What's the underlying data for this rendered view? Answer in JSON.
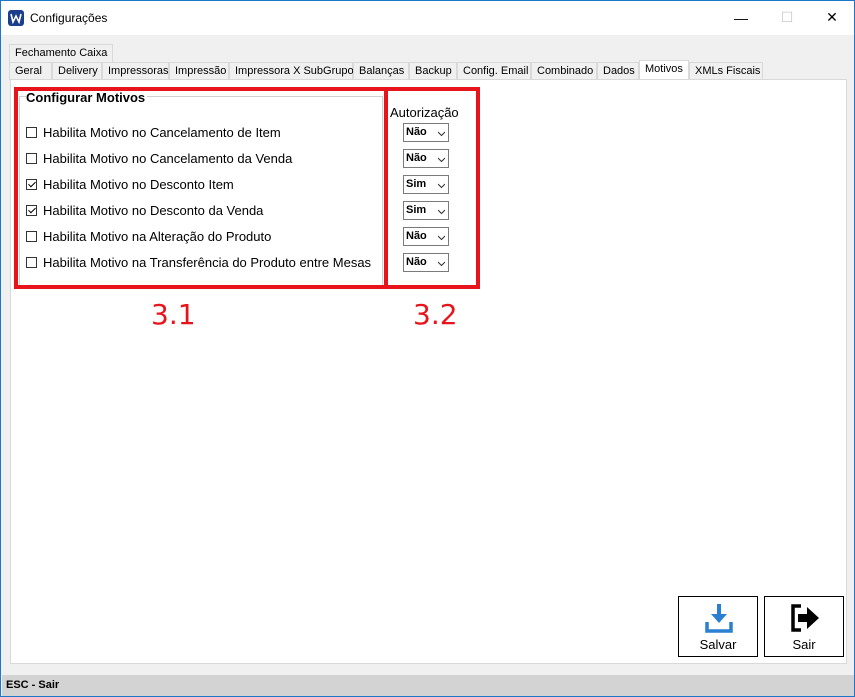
{
  "window": {
    "title": "Configurações",
    "minimize_glyph": "—",
    "maximize_glyph": "☐",
    "close_glyph": "✕"
  },
  "tabs_row1": [
    {
      "label": "Fechamento Caixa"
    }
  ],
  "tabs_row2": [
    {
      "label": "Geral"
    },
    {
      "label": "Delivery"
    },
    {
      "label": "Impressoras"
    },
    {
      "label": "Impressão"
    },
    {
      "label": "Impressora X SubGrupo"
    },
    {
      "label": "Balanças"
    },
    {
      "label": "Backup"
    },
    {
      "label": "Config. Email"
    },
    {
      "label": "Combinado"
    },
    {
      "label": "Dados"
    },
    {
      "label": "Motivos",
      "active": true
    },
    {
      "label": "XMLs Fiscais"
    }
  ],
  "motivos": {
    "group_title": "Configurar Motivos",
    "authorization_label": "Autorização",
    "items": [
      {
        "label": "Habilita Motivo no Cancelamento de Item",
        "checked": false,
        "authorization": "Não"
      },
      {
        "label": "Habilita Motivo no Cancelamento da Venda",
        "checked": false,
        "authorization": "Não"
      },
      {
        "label": "Habilita Motivo no Desconto Item",
        "checked": true,
        "authorization": "Sim"
      },
      {
        "label": "Habilita Motivo no Desconto da Venda",
        "checked": true,
        "authorization": "Sim"
      },
      {
        "label": "Habilita Motivo na Alteração do Produto",
        "checked": false,
        "authorization": "Não"
      },
      {
        "label": "Habilita Motivo na Transferência do Produto entre Mesas",
        "checked": false,
        "authorization": "Não"
      }
    ]
  },
  "annotations": {
    "left": "3.1",
    "right": "3.2",
    "color": "#e8141b"
  },
  "buttons": {
    "save_label": "Salvar",
    "exit_label": "Sair"
  },
  "status": {
    "text": "ESC - Sair"
  },
  "colors": {
    "accent_blue": "#2a7fd0",
    "status_bg": "#d3d3d3"
  }
}
